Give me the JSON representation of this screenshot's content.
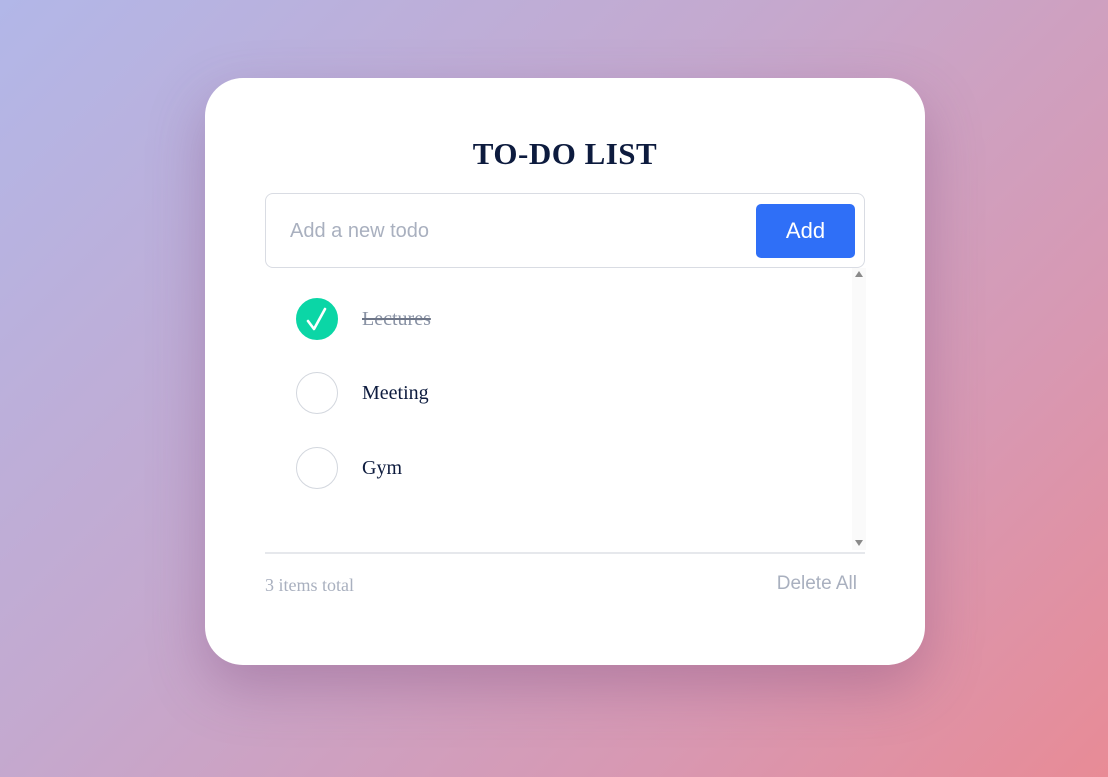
{
  "app": {
    "title": "TO-DO LIST"
  },
  "input": {
    "placeholder": "Add a new todo",
    "value": ""
  },
  "buttons": {
    "add_label": "Add",
    "delete_all_label": "Delete All"
  },
  "todos": [
    {
      "text": "Lectures",
      "done": true
    },
    {
      "text": "Meeting",
      "done": false
    },
    {
      "text": "Gym",
      "done": false
    }
  ],
  "footer": {
    "count_text": "3 items total"
  },
  "colors": {
    "accent": "#2f6ff7",
    "done": "#0bd6a6",
    "title": "#0d1b3e",
    "muted": "#a9b0bf"
  },
  "icons": {
    "check": "checkmark-icon"
  }
}
